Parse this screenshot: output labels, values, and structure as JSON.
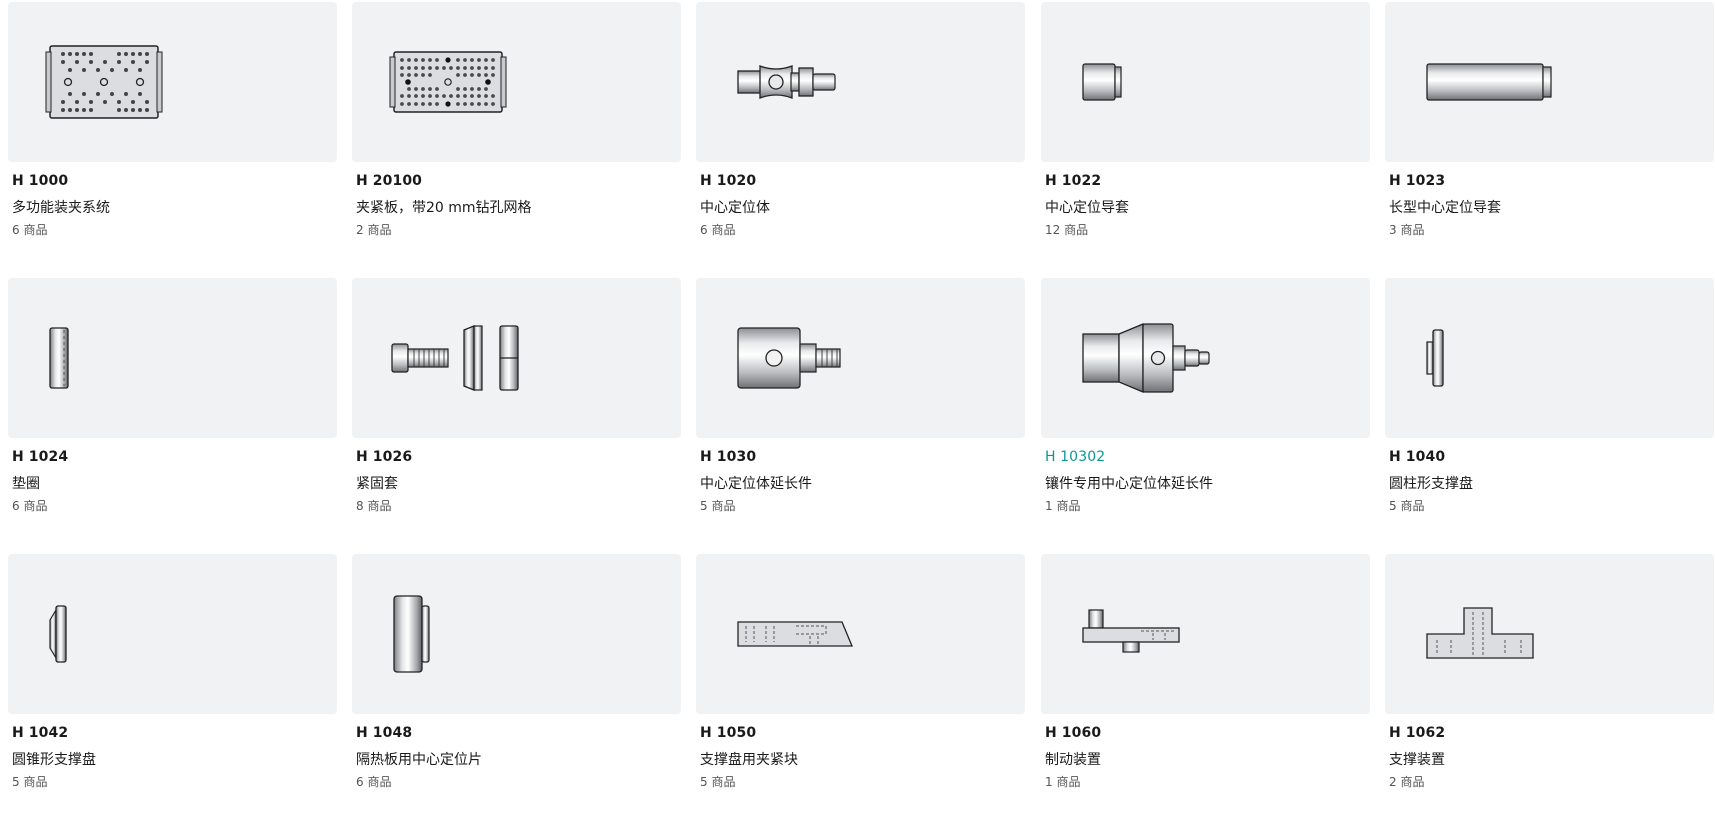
{
  "accent_color": "#0a9a96",
  "products": [
    {
      "code": "H 1000",
      "name": "多功能装夹系统",
      "count": "6 商品",
      "icon": "multi-function-clamping-plate-icon"
    },
    {
      "code": "H 20100",
      "name": "夹紧板，带20 mm钻孔网格",
      "count": "2 商品",
      "icon": "clamping-plate-grid-icon"
    },
    {
      "code": "H 1020",
      "name": "中心定位体",
      "count": "6 商品",
      "icon": "centering-body-icon"
    },
    {
      "code": "H 1022",
      "name": "中心定位导套",
      "count": "12 商品",
      "icon": "centering-sleeve-icon"
    },
    {
      "code": "H 1023",
      "name": "长型中心定位导套",
      "count": "3 商品",
      "icon": "long-centering-sleeve-icon"
    },
    {
      "code": "H 1024",
      "name": "垫圈",
      "count": "6 商品",
      "icon": "washer-icon"
    },
    {
      "code": "H 1026",
      "name": "紧固套",
      "count": "8 商品",
      "icon": "fastening-sleeve-icon"
    },
    {
      "code": "H 1030",
      "name": "中心定位体延长件",
      "count": "5 商品",
      "icon": "centering-extension-icon"
    },
    {
      "code": "H 10302",
      "name": "镶件专用中心定位体延长件",
      "count": "1 商品",
      "icon": "insert-centering-extension-icon",
      "highlight": true
    },
    {
      "code": "H 1040",
      "name": "圆柱形支撑盘",
      "count": "5 商品",
      "icon": "cylindrical-support-disc-icon"
    },
    {
      "code": "H 1042",
      "name": "圆锥形支撑盘",
      "count": "5 商品",
      "icon": "conical-support-disc-icon"
    },
    {
      "code": "H 1048",
      "name": "隔热板用中心定位片",
      "count": "6 商品",
      "icon": "insulation-centering-piece-icon"
    },
    {
      "code": "H 1050",
      "name": "支撑盘用夹紧块",
      "count": "5 商品",
      "icon": "clamping-block-icon"
    },
    {
      "code": "H 1060",
      "name": "制动装置",
      "count": "1 商品",
      "icon": "brake-device-icon"
    },
    {
      "code": "H 1062",
      "name": "支撑装置",
      "count": "2 商品",
      "icon": "support-device-icon"
    }
  ]
}
